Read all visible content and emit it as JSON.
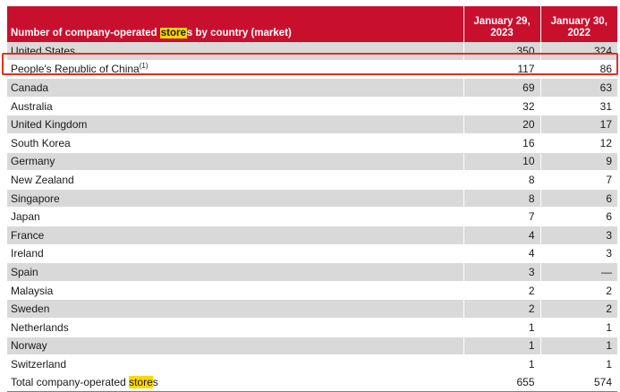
{
  "header": {
    "label_prefix": "Number of company-operated ",
    "label_highlight": "store",
    "label_suffix": "s by country (market)",
    "col1": "January 29, 2023",
    "col2": "January 30, 2022"
  },
  "rows": [
    {
      "country": "United States",
      "sup": "",
      "v2023": "350",
      "v2022": "324"
    },
    {
      "country": "People's Republic of China",
      "sup": "(1)",
      "v2023": "117",
      "v2022": "86"
    },
    {
      "country": "Canada",
      "sup": "",
      "v2023": "69",
      "v2022": "63"
    },
    {
      "country": "Australia",
      "sup": "",
      "v2023": "32",
      "v2022": "31"
    },
    {
      "country": "United Kingdom",
      "sup": "",
      "v2023": "20",
      "v2022": "17"
    },
    {
      "country": "South Korea",
      "sup": "",
      "v2023": "16",
      "v2022": "12"
    },
    {
      "country": "Germany",
      "sup": "",
      "v2023": "10",
      "v2022": "9"
    },
    {
      "country": "New Zealand",
      "sup": "",
      "v2023": "8",
      "v2022": "7"
    },
    {
      "country": "Singapore",
      "sup": "",
      "v2023": "8",
      "v2022": "6"
    },
    {
      "country": "Japan",
      "sup": "",
      "v2023": "7",
      "v2022": "6"
    },
    {
      "country": "France",
      "sup": "",
      "v2023": "4",
      "v2022": "3"
    },
    {
      "country": "Ireland",
      "sup": "",
      "v2023": "4",
      "v2022": "3"
    },
    {
      "country": "Spain",
      "sup": "",
      "v2023": "3",
      "v2022": "—"
    },
    {
      "country": "Malaysia",
      "sup": "",
      "v2023": "2",
      "v2022": "2"
    },
    {
      "country": "Sweden",
      "sup": "",
      "v2023": "2",
      "v2022": "2"
    },
    {
      "country": "Netherlands",
      "sup": "",
      "v2023": "1",
      "v2022": "1"
    },
    {
      "country": "Norway",
      "sup": "",
      "v2023": "1",
      "v2022": "1"
    },
    {
      "country": "Switzerland",
      "sup": "",
      "v2023": "1",
      "v2022": "1"
    }
  ],
  "total": {
    "label_prefix": "Total company-operated ",
    "label_highlight": "store",
    "label_suffix": "s",
    "v2023": "655",
    "v2022": "574"
  },
  "colors": {
    "header_red": "#c8102e",
    "row_shade": "#d9d9d9",
    "search_highlight": "#ffd700",
    "annotation_box": "#e03020"
  }
}
